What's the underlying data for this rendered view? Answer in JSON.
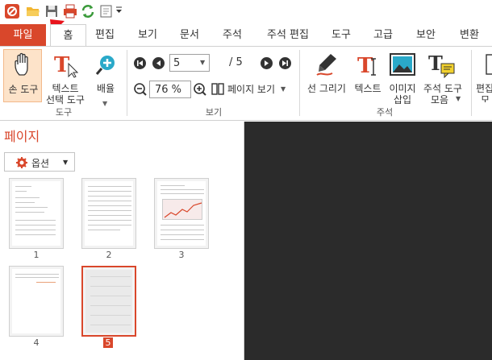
{
  "tabs": [
    "파일",
    "홈",
    "편집",
    "보기",
    "문서",
    "주석",
    "주석 편집",
    "도구",
    "고급",
    "보안",
    "변환"
  ],
  "ribbon": {
    "hand_tool": "손 도구",
    "text_select_tool": [
      "텍스트",
      "선택 도구"
    ],
    "zoom": "배율",
    "tools_group": "도구",
    "page_value": "5",
    "page_total": "/ 5",
    "zoom_value": "76 %",
    "page_view": "페이지 보기",
    "view_group": "보기",
    "draw_line": "선 그리기",
    "text": "텍스트",
    "image_insert": [
      "이미지",
      "삽입"
    ],
    "annot_tools": [
      "주석 도구",
      "모음"
    ],
    "annot_group": "주석",
    "edit_partial": [
      "편집",
      "모"
    ]
  },
  "panel": {
    "title": "페이지",
    "options_button": "옵션",
    "thumbnails": [
      "1",
      "2",
      "3",
      "4",
      "5"
    ],
    "selected_page": "5"
  },
  "colors": {
    "accent": "#d9472b",
    "canvas": "#2b2b2b"
  }
}
